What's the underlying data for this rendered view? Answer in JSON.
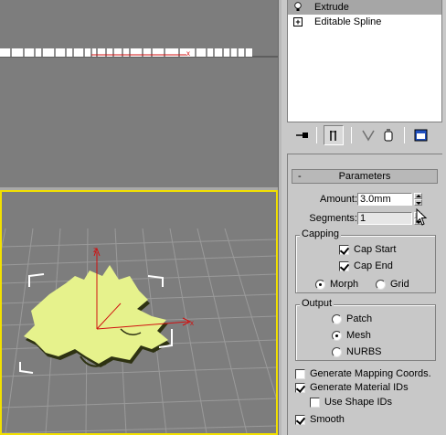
{
  "modifier_stack": {
    "items": [
      {
        "label": "Extrude",
        "selected": true,
        "icon": "lightbulb-icon"
      },
      {
        "label": "Editable Spline",
        "selected": false,
        "icon": "expand-plus-icon"
      }
    ]
  },
  "stack_tools": [
    "pin-stack-icon",
    "show-end-result-icon",
    "make-unique-icon",
    "remove-modifier-icon",
    "configure-modifier-sets-icon"
  ],
  "parameters": {
    "rollout_title": "Parameters",
    "collapse_symbol": "-",
    "amount_label": "Amount:",
    "amount_value": "3.0mm",
    "segments_label": "Segments:",
    "segments_value": "1",
    "capping": {
      "title": "Capping",
      "cap_start_label": "Cap Start",
      "cap_start": true,
      "cap_end_label": "Cap End",
      "cap_end": true,
      "morph_label": "Morph",
      "grid_label": "Grid",
      "selected": "Morph"
    },
    "output": {
      "title": "Output",
      "patch_label": "Patch",
      "mesh_label": "Mesh",
      "nurbs_label": "NURBS",
      "selected": "Mesh"
    },
    "generate_mapping_label": "Generate Mapping Coords.",
    "generate_mapping": false,
    "generate_material_ids_label": "Generate Material IDs",
    "generate_material_ids": true,
    "use_shape_ids_label": "Use Shape IDs",
    "use_shape_ids": false,
    "smooth_label": "Smooth",
    "smooth": true
  },
  "colors": {
    "viewport_bg": "#7d7d7d",
    "active_viewport_border": "#f2e000",
    "shape_fill": "#e6f28c",
    "gizmo_axis": "#d01010",
    "selection_brackets": "#ffffff"
  }
}
